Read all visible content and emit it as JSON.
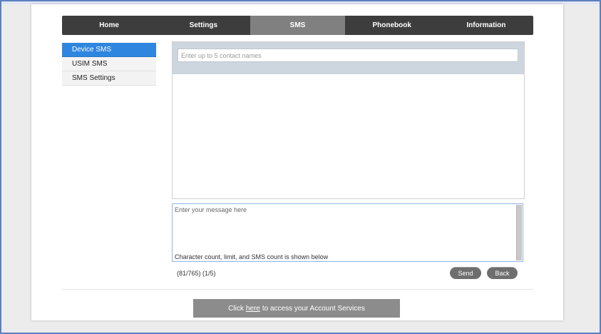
{
  "nav": {
    "items": [
      {
        "label": "Home"
      },
      {
        "label": "Settings"
      },
      {
        "label": "SMS"
      },
      {
        "label": "Phonebook"
      },
      {
        "label": "Information"
      }
    ],
    "active": "SMS"
  },
  "sidebar": {
    "items": [
      {
        "label": "Device SMS"
      },
      {
        "label": "USIM SMS"
      },
      {
        "label": "SMS Settings"
      }
    ],
    "active": "Device SMS"
  },
  "contacts": {
    "placeholder": "Enter up to 5 contact names"
  },
  "message": {
    "line1": "Enter your message here",
    "line2": "Character count, limit, and SMS count is shown below"
  },
  "counter": "(81/765) (1/5)",
  "buttons": {
    "send": "Send",
    "back": "Back"
  },
  "footer": {
    "prefix": "Click",
    "link": "here",
    "suffix": "to access your Account Services"
  },
  "colors": {
    "nav_bg": "#3d3d3d",
    "nav_active": "#808080",
    "sidebar_active": "#2e86de",
    "button": "#6e6e6e"
  }
}
